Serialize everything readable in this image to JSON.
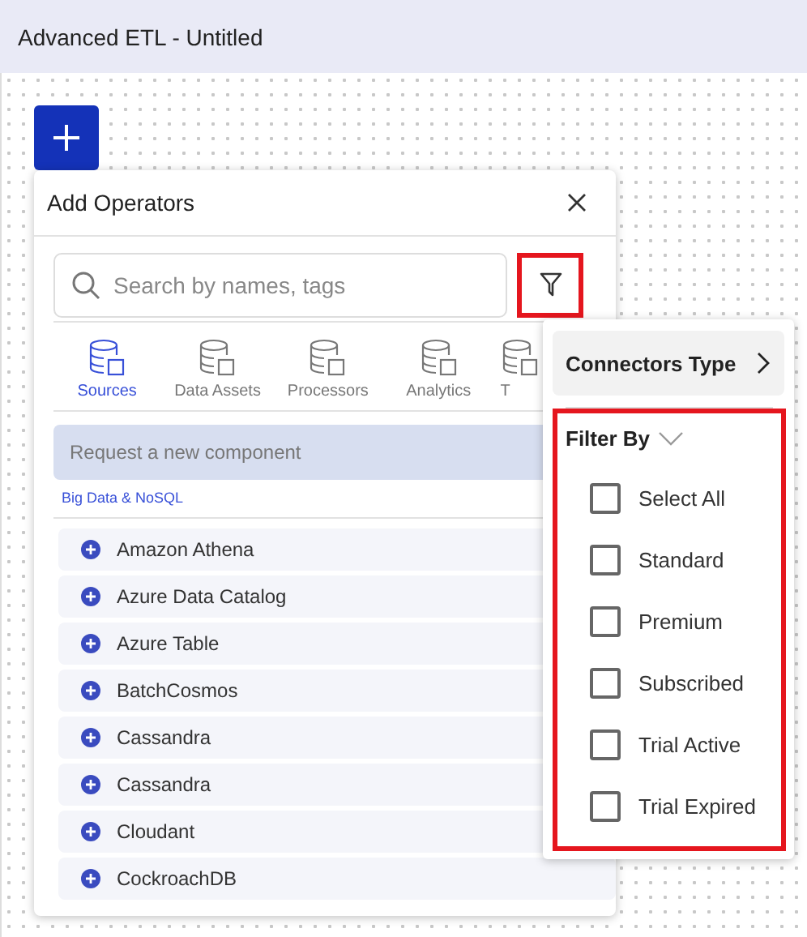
{
  "window": {
    "title": "Advanced ETL - Untitled"
  },
  "panel": {
    "title": "Add Operators",
    "search": {
      "placeholder": "Search by names, tags"
    },
    "tabs": [
      {
        "label": "Sources",
        "selected": true
      },
      {
        "label": "Data Assets",
        "selected": false
      },
      {
        "label": "Processors",
        "selected": false
      },
      {
        "label": "Analytics",
        "selected": false
      },
      {
        "label": "T",
        "selected": false
      }
    ],
    "request_button": "Request a new component",
    "category": "Big Data & NoSQL",
    "items": [
      "Amazon Athena",
      "Azure Data Catalog",
      "Azure Table",
      "BatchCosmos",
      "Cassandra",
      "Cassandra",
      "Cloudant",
      "CockroachDB"
    ]
  },
  "filter_menu": {
    "connectors_type": "Connectors Type",
    "filter_by": {
      "label": "Filter By",
      "expanded": true
    },
    "options": [
      {
        "label": "Select All",
        "checked": false
      },
      {
        "label": "Standard",
        "checked": false
      },
      {
        "label": "Premium",
        "checked": false
      },
      {
        "label": "Subscribed",
        "checked": false
      },
      {
        "label": "Trial Active",
        "checked": false
      },
      {
        "label": "Trial Expired",
        "checked": false
      }
    ]
  }
}
